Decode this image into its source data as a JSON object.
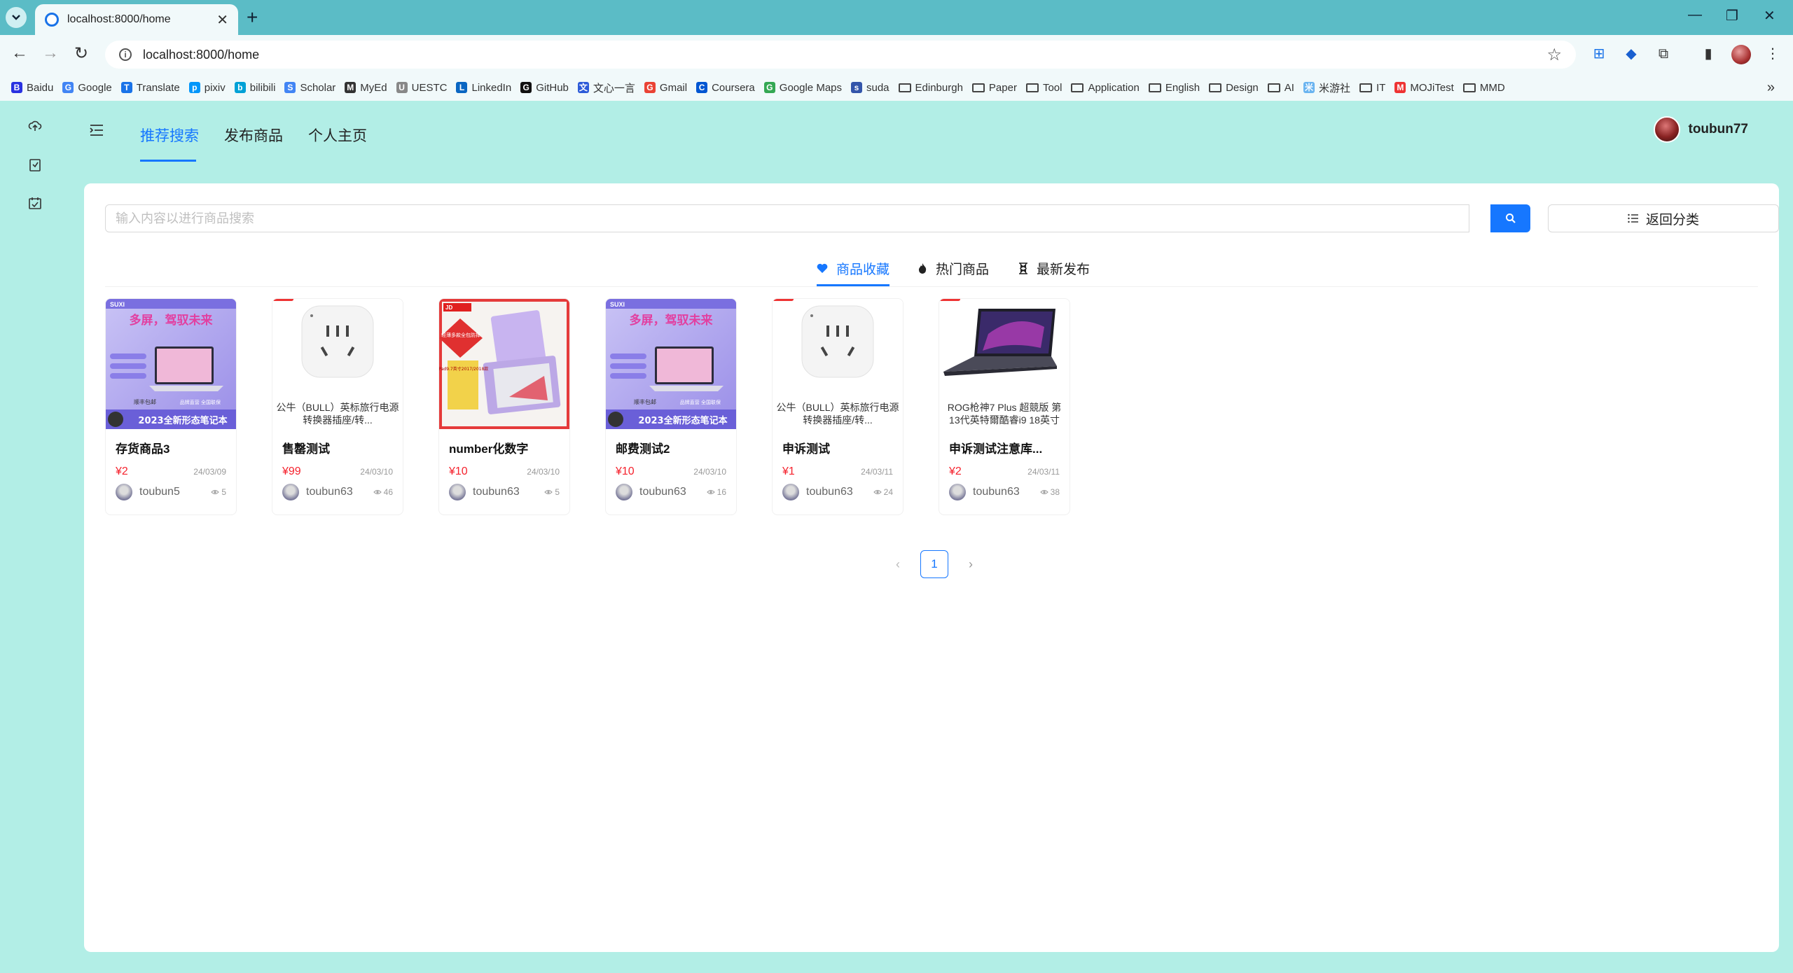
{
  "browser": {
    "tab_title": "localhost:8000/home",
    "url": "localhost:8000/home",
    "bookmarks": [
      {
        "label": "Baidu",
        "icon": "baidu-icon",
        "color": "#2932e1"
      },
      {
        "label": "Google",
        "icon": "google-icon",
        "color": "#4285f4"
      },
      {
        "label": "Translate",
        "icon": "translate-icon",
        "color": "#1a73e8"
      },
      {
        "label": "pixiv",
        "icon": "pixiv-icon",
        "color": "#0096fa"
      },
      {
        "label": "bilibili",
        "icon": "bilibili-icon",
        "color": "#00a1d6"
      },
      {
        "label": "Scholar",
        "icon": "scholar-icon",
        "color": "#4285f4"
      },
      {
        "label": "MyEd",
        "icon": "myed-icon",
        "color": "#333333"
      },
      {
        "label": "UESTC",
        "icon": "uestc-icon",
        "color": "#888888"
      },
      {
        "label": "LinkedIn",
        "icon": "linkedin-icon",
        "color": "#0a66c2"
      },
      {
        "label": "GitHub",
        "icon": "github-icon",
        "color": "#111111"
      },
      {
        "label": "文心一言",
        "icon": "wenxin-icon",
        "color": "#2d5bd8"
      },
      {
        "label": "Gmail",
        "icon": "gmail-icon",
        "color": "#ea4335"
      },
      {
        "label": "Coursera",
        "icon": "coursera-icon",
        "color": "#0056d2"
      },
      {
        "label": "Google Maps",
        "icon": "maps-icon",
        "color": "#34a853"
      },
      {
        "label": "suda",
        "icon": "suda-icon",
        "color": "#3355aa"
      },
      {
        "label": "Edinburgh",
        "icon": "folder-icon",
        "color": ""
      },
      {
        "label": "Paper",
        "icon": "folder-icon",
        "color": ""
      },
      {
        "label": "Tool",
        "icon": "folder-icon",
        "color": ""
      },
      {
        "label": "Application",
        "icon": "folder-icon",
        "color": ""
      },
      {
        "label": "English",
        "icon": "folder-icon",
        "color": ""
      },
      {
        "label": "Design",
        "icon": "folder-icon",
        "color": ""
      },
      {
        "label": "AI",
        "icon": "folder-icon",
        "color": ""
      },
      {
        "label": "米游社",
        "icon": "miyoushe-icon",
        "color": "#6ab4f0"
      },
      {
        "label": "IT",
        "icon": "folder-icon",
        "color": ""
      },
      {
        "label": "MOJiTest",
        "icon": "mojitest-icon",
        "color": "#e33"
      },
      {
        "label": "MMD",
        "icon": "folder-icon",
        "color": ""
      }
    ]
  },
  "nav": {
    "items": [
      "推荐搜索",
      "发布商品",
      "个人主页"
    ],
    "active_index": 0,
    "username": "toubun77"
  },
  "search": {
    "placeholder": "输入内容以进行商品搜索",
    "value": "",
    "back_label": "返回分类"
  },
  "tabs": [
    {
      "label": "商品收藏",
      "icon": "heart-icon",
      "active": true
    },
    {
      "label": "热门商品",
      "icon": "fire-icon",
      "active": false
    },
    {
      "label": "最新发布",
      "icon": "hourglass-icon",
      "active": false
    }
  ],
  "products": [
    {
      "title": "存货商品3",
      "price": "¥2",
      "date": "24/03/09",
      "owner": "toubun5",
      "views": "5",
      "image": "laptop-banner",
      "caption": ""
    },
    {
      "title": "售罄测试",
      "price": "¥99",
      "date": "24/03/10",
      "owner": "toubun63",
      "views": "46",
      "image": "power-socket",
      "caption": "公牛（BULL）英标旅行电源转换器插座/转..."
    },
    {
      "title": "number化数字",
      "price": "¥10",
      "date": "24/03/10",
      "owner": "toubun63",
      "views": "5",
      "image": "ipad-case",
      "caption": ""
    },
    {
      "title": "邮费测试2",
      "price": "¥10",
      "date": "24/03/10",
      "owner": "toubun63",
      "views": "16",
      "image": "laptop-banner",
      "caption": ""
    },
    {
      "title": "申诉测试",
      "price": "¥1",
      "date": "24/03/11",
      "owner": "toubun63",
      "views": "24",
      "image": "power-socket",
      "caption": "公牛（BULL）英标旅行电源转换器插座/转..."
    },
    {
      "title": "申诉测试注意库...",
      "price": "¥2",
      "date": "24/03/11",
      "owner": "toubun63",
      "views": "38",
      "image": "gaming-laptop",
      "caption": "ROG枪神7 Plus 超競版 第13代英特爾酷睿i9 18英寸"
    }
  ],
  "banner": {
    "brand": "SUXI",
    "slogan": "多屏，驾驭未来",
    "footer": "2023全新形态笔记本",
    "badge": "顺丰包邮",
    "tag": "品牌直营 全国联保"
  },
  "ipad_ad": {
    "brand": "JD",
    "promo": "轻薄多款全包防摔",
    "model": "iPad9.7英寸2017/2018款"
  },
  "pagination": {
    "current": "1"
  },
  "colors": {
    "accent": "#1677ff",
    "price": "#f5222d",
    "background": "#b2eee6",
    "browser_frame": "#5bbcc6"
  }
}
